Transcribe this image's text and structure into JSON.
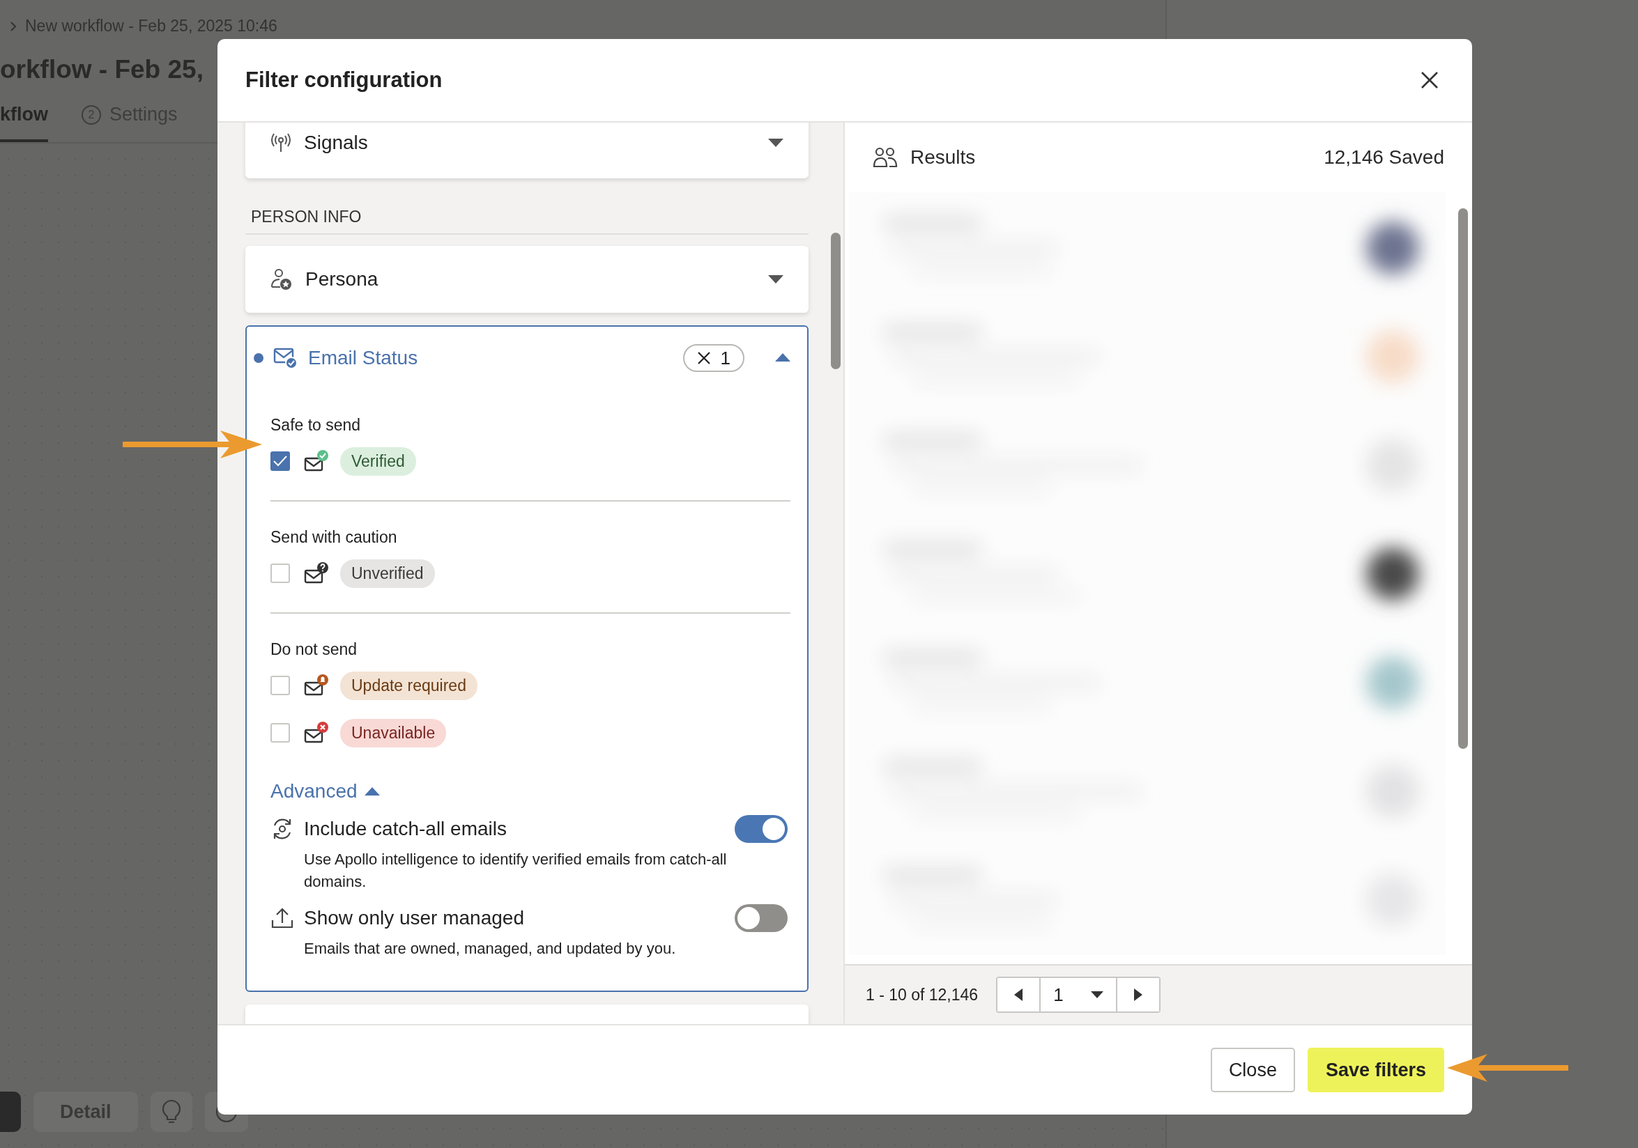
{
  "background": {
    "breadcrumb": "New workflow - Feb 25, 2025 10:46",
    "title": "orkflow - Feb 25,",
    "tabs": [
      {
        "label": "kflow",
        "selected": true
      },
      {
        "number": "2",
        "label": "Settings",
        "selected": false
      }
    ],
    "toolbar_button": "Detail"
  },
  "dialog": {
    "title": "Filter configuration",
    "filters": [
      {
        "kind": "filter",
        "label": "Signals",
        "expanded": false
      },
      {
        "kind": "heading",
        "label": "PERSON INFO"
      },
      {
        "kind": "filter",
        "label": "Persona",
        "expanded": false
      },
      {
        "kind": "group",
        "label": "Email Status",
        "expanded": true,
        "active": true,
        "count": "1",
        "groups": [
          {
            "label": "Safe to send",
            "options": [
              {
                "label": "Verified",
                "kind": "verified",
                "checked": true
              }
            ]
          },
          {
            "label": "Send with caution",
            "options": [
              {
                "label": "Unverified",
                "kind": "unverified",
                "checked": false
              }
            ]
          },
          {
            "label": "Do not send",
            "options": [
              {
                "label": "Update required",
                "kind": "update",
                "checked": false
              },
              {
                "label": "Unavailable",
                "kind": "unavailable",
                "checked": false
              }
            ]
          }
        ],
        "advanced": {
          "label": "Advanced",
          "expanded": true,
          "options": [
            {
              "title": "Include catch-all emails",
              "description": "Use Apollo intelligence to identify verified emails from catch-all domains.",
              "on": true
            },
            {
              "title": "Show only user managed",
              "description": "Emails that are owned, managed, and updated by you.",
              "on": false
            }
          ]
        }
      },
      {
        "kind": "filter"
      }
    ],
    "results": {
      "title": "Results",
      "count": "12,146 Saved",
      "range": "1 - 10 of 12,146",
      "page": "1"
    },
    "buttons": [
      {
        "kind": "secondary",
        "label": "Close"
      },
      {
        "kind": "primary",
        "label": "Save filters"
      }
    ]
  }
}
